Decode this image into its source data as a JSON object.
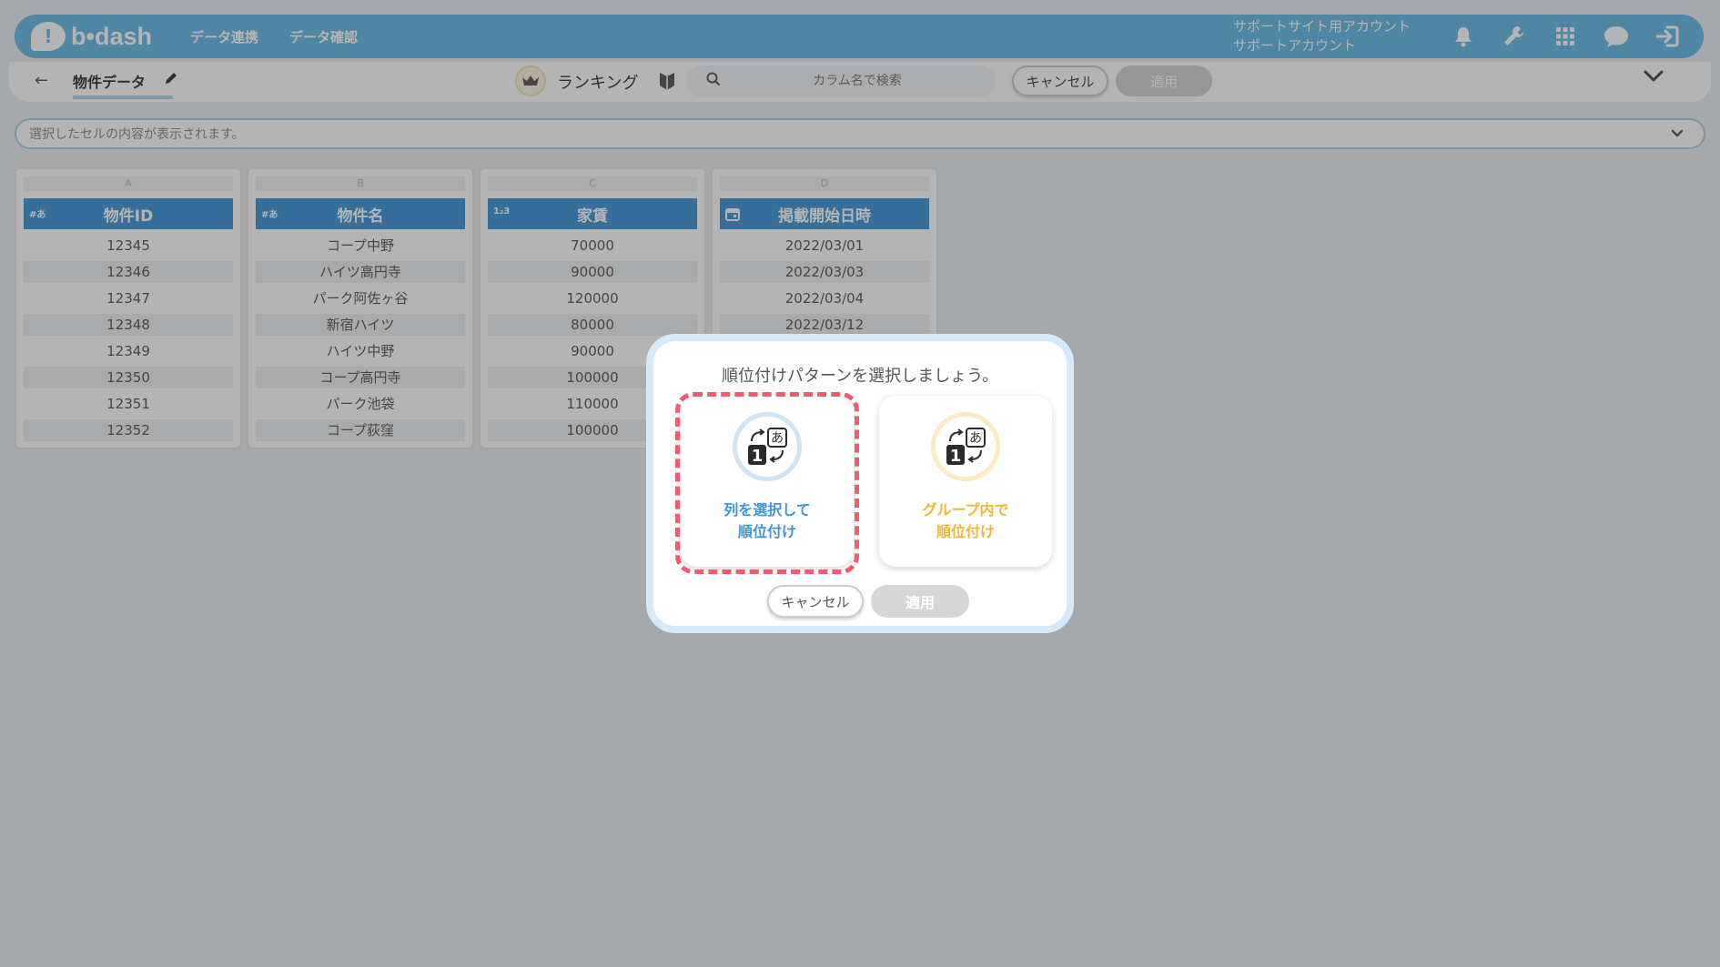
{
  "header": {
    "logo_text": "b•dash",
    "nav": [
      "データ連携",
      "データ確認"
    ],
    "account_line1": "サポートサイト用アカウント",
    "account_line2": "サポートアカウント",
    "icons": [
      "bell-icon",
      "wrench-icon",
      "grid-icon",
      "chat-icon",
      "logout-icon"
    ],
    "color": "#65b9e6"
  },
  "toolbar": {
    "back_label": "←",
    "title": "物件データ",
    "ranking_label": "ランキング",
    "search_placeholder": "カラム名で検索",
    "cancel_label": "キャンセル",
    "apply_label": "適用"
  },
  "cell_bar": {
    "placeholder": "選択したセルの内容が表示されます。"
  },
  "table": {
    "columns": [
      {
        "letter": "A",
        "type": "#あ",
        "name": "物件ID",
        "cells": [
          "12345",
          "12346",
          "12347",
          "12348",
          "12349",
          "12350",
          "12351",
          "12352"
        ]
      },
      {
        "letter": "B",
        "type": "#あ",
        "name": "物件名",
        "cells": [
          "コープ中野",
          "ハイツ高円寺",
          "パーク阿佐ヶ谷",
          "新宿ハイツ",
          "ハイツ中野",
          "コープ高円寺",
          "パーク池袋",
          "コープ荻窪"
        ]
      },
      {
        "letter": "C",
        "type": "1₂3",
        "name": "家賃",
        "cells": [
          "70000",
          "90000",
          "120000",
          "80000",
          "90000",
          "100000",
          "110000",
          "100000"
        ]
      },
      {
        "letter": "D",
        "type": "calendar-icon",
        "name": "掲載開始日時",
        "cells": [
          "2022/03/01",
          "2022/03/03",
          "2022/03/04",
          "2022/03/12"
        ]
      }
    ],
    "header_color": "#3e96d8"
  },
  "modal": {
    "title": "順位付けパターンを選択しましょう。",
    "option1_line1": "列を選択して",
    "option1_line2": "順位付け",
    "option2_line1": "グループ内で",
    "option2_line2": "順位付け",
    "cancel_label": "キャンセル",
    "apply_label": "適用",
    "highlight_color": "#f25a6d"
  }
}
